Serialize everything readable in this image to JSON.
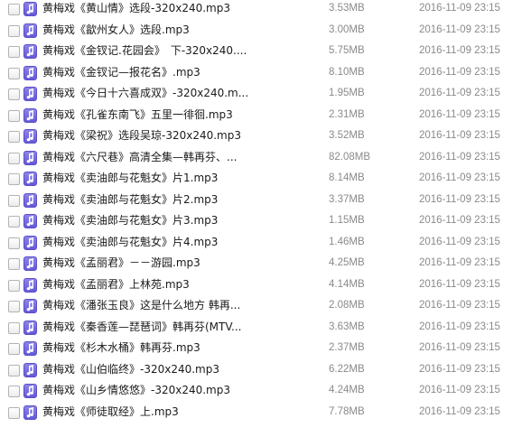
{
  "file_list": {
    "rows": [
      {
        "name": "黄梅戏《黄山情》选段-320x240.mp3",
        "size": "3.53MB",
        "date": "2016-11-09 23:15"
      },
      {
        "name": "黄梅戏《歙州女人》选段.mp3",
        "size": "3.00MB",
        "date": "2016-11-09 23:15"
      },
      {
        "name": "黄梅戏《金钗记.花园会》　下-320x240....",
        "size": "5.75MB",
        "date": "2016-11-09 23:15"
      },
      {
        "name": "黄梅戏《金钗记—报花名》.mp3",
        "size": "8.10MB",
        "date": "2016-11-09 23:15"
      },
      {
        "name": "黄梅戏《今日十六喜成双》-320x240.m...",
        "size": "1.95MB",
        "date": "2016-11-09 23:15"
      },
      {
        "name": "黄梅戏《孔雀东南飞》五里一徘徊.mp3",
        "size": "2.31MB",
        "date": "2016-11-09 23:15"
      },
      {
        "name": "黄梅戏《梁祝》选段吴琼-320x240.mp3",
        "size": "3.52MB",
        "date": "2016-11-09 23:15"
      },
      {
        "name": "黄梅戏《六尺巷》高清全集—韩再芬、...",
        "size": "82.08MB",
        "date": "2016-11-09 23:15"
      },
      {
        "name": "黄梅戏《卖油郎与花魁女》片1.mp3",
        "size": "8.14MB",
        "date": "2016-11-09 23:15"
      },
      {
        "name": "黄梅戏《卖油郎与花魁女》片2.mp3",
        "size": "3.37MB",
        "date": "2016-11-09 23:15"
      },
      {
        "name": "黄梅戏《卖油郎与花魁女》片3.mp3",
        "size": "1.15MB",
        "date": "2016-11-09 23:15"
      },
      {
        "name": "黄梅戏《卖油郎与花魁女》片4.mp3",
        "size": "1.46MB",
        "date": "2016-11-09 23:15"
      },
      {
        "name": "黄梅戏《孟丽君》－－游园.mp3",
        "size": "4.25MB",
        "date": "2016-11-09 23:15"
      },
      {
        "name": "黄梅戏《孟丽君》上林苑.mp3",
        "size": "4.14MB",
        "date": "2016-11-09 23:15"
      },
      {
        "name": "黄梅戏《潘张玉良》这是什么地方 韩再...",
        "size": "2.08MB",
        "date": "2016-11-09 23:15"
      },
      {
        "name": "黄梅戏《秦香莲—琵琶词》韩再芬(MTV...",
        "size": "3.63MB",
        "date": "2016-11-09 23:15"
      },
      {
        "name": "黄梅戏《杉木水桶》韩再芬.mp3",
        "size": "2.37MB",
        "date": "2016-11-09 23:15"
      },
      {
        "name": "黄梅戏《山伯临终》-320x240.mp3",
        "size": "6.22MB",
        "date": "2016-11-09 23:15"
      },
      {
        "name": "黄梅戏《山乡情悠悠》-320x240.mp3",
        "size": "4.24MB",
        "date": "2016-11-09 23:15"
      },
      {
        "name": "黄梅戏《师徒取经》上.mp3",
        "size": "7.78MB",
        "date": "2016-11-09 23:15"
      }
    ]
  },
  "icons": {
    "file_type": "music-note-icon",
    "accent": "#6a5ee0"
  }
}
